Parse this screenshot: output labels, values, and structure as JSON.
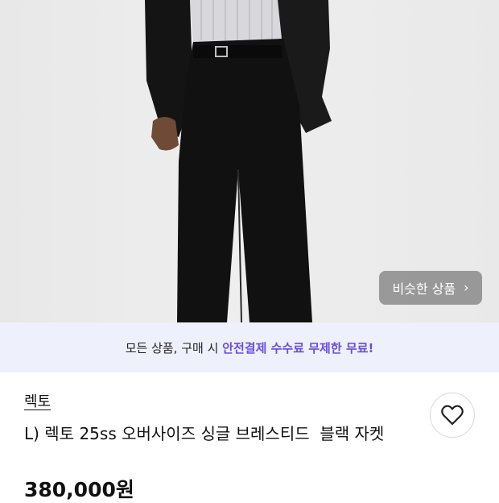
{
  "product_image": {
    "alt": "product-photo"
  },
  "similar_button": {
    "label": "비슷한 상품",
    "chevron": "›"
  },
  "banner": {
    "prefix": "모든 상품, 구매 시 ",
    "highlight": "안전결제 수수료 무제한 무료!"
  },
  "product": {
    "brand": "렉토",
    "title": "L) 렉토 25ss 오버사이즈 싱글 브레스티드  블랙 자켓",
    "price": "380,000원"
  },
  "icons": {
    "like": "heart-icon",
    "chevron": "chevron-right-icon"
  },
  "colors": {
    "accent": "#6a4fd8",
    "banner_bg": "#eef0fb"
  }
}
